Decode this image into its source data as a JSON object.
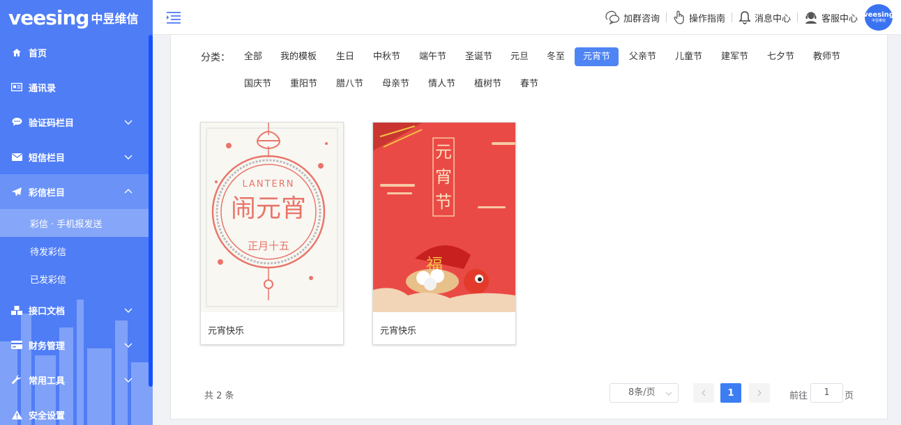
{
  "brand": {
    "logo_word": "veesing",
    "logo_cn": "中昱维信"
  },
  "sidebar": {
    "items": [
      {
        "label": "首页",
        "icon": "home-icon"
      },
      {
        "label": "通讯录",
        "icon": "contacts-icon"
      },
      {
        "label": "验证码栏目",
        "icon": "chat-icon"
      },
      {
        "label": "短信栏目",
        "icon": "envelope-icon"
      },
      {
        "label": "彩信栏目",
        "icon": "send-icon"
      }
    ],
    "sub_items": [
      {
        "label": "彩信 · 手机报发送"
      },
      {
        "label": "待发彩信"
      },
      {
        "label": "已发彩信"
      }
    ],
    "items_after": [
      {
        "label": "接口文档",
        "icon": "cubes-icon"
      },
      {
        "label": "财务管理",
        "icon": "credit-card-icon"
      },
      {
        "label": "常用工具",
        "icon": "wrench-icon"
      },
      {
        "label": "安全设置",
        "icon": "warning-icon"
      }
    ]
  },
  "header": {
    "links": [
      {
        "label": "加群咨询",
        "icon": "group-chat-icon"
      },
      {
        "label": "操作指南",
        "icon": "pointer-hand-icon"
      },
      {
        "label": "消息中心",
        "icon": "bell-icon"
      },
      {
        "label": "客服中心",
        "icon": "customer-service-icon"
      }
    ],
    "avatar": {
      "line1": "veesing",
      "line2": "中昱维信"
    }
  },
  "categories": {
    "label": "分类：",
    "items": [
      "全部",
      "我的模板",
      "生日",
      "中秋节",
      "端午节",
      "圣诞节",
      "元旦",
      "冬至",
      "元宵节",
      "父亲节",
      "儿童节",
      "建军节",
      "七夕节",
      "教师节",
      "国庆节",
      "重阳节",
      "腊八节",
      "母亲节",
      "情人节",
      "植树节",
      "春节"
    ],
    "active": "元宵节"
  },
  "templates": [
    {
      "name": "元宵快乐",
      "image_text": {
        "en": "LANTERN",
        "title": "闹元宵",
        "date": "正月十五"
      }
    },
    {
      "name": "元宵快乐",
      "image_text": {
        "title": [
          "元",
          "宵",
          "节"
        ],
        "fu": "福"
      }
    }
  ],
  "pagination": {
    "total": "共 2 条",
    "page_size": "8条/页",
    "current_page": "1",
    "goto_label": "前往",
    "goto_value": "1",
    "goto_unit": "页"
  },
  "colors": {
    "sidebar": "#4f7df6",
    "accent": "#4f84f4",
    "card1_accent": "#e9756a",
    "card2_bg": "#ea4a45"
  }
}
